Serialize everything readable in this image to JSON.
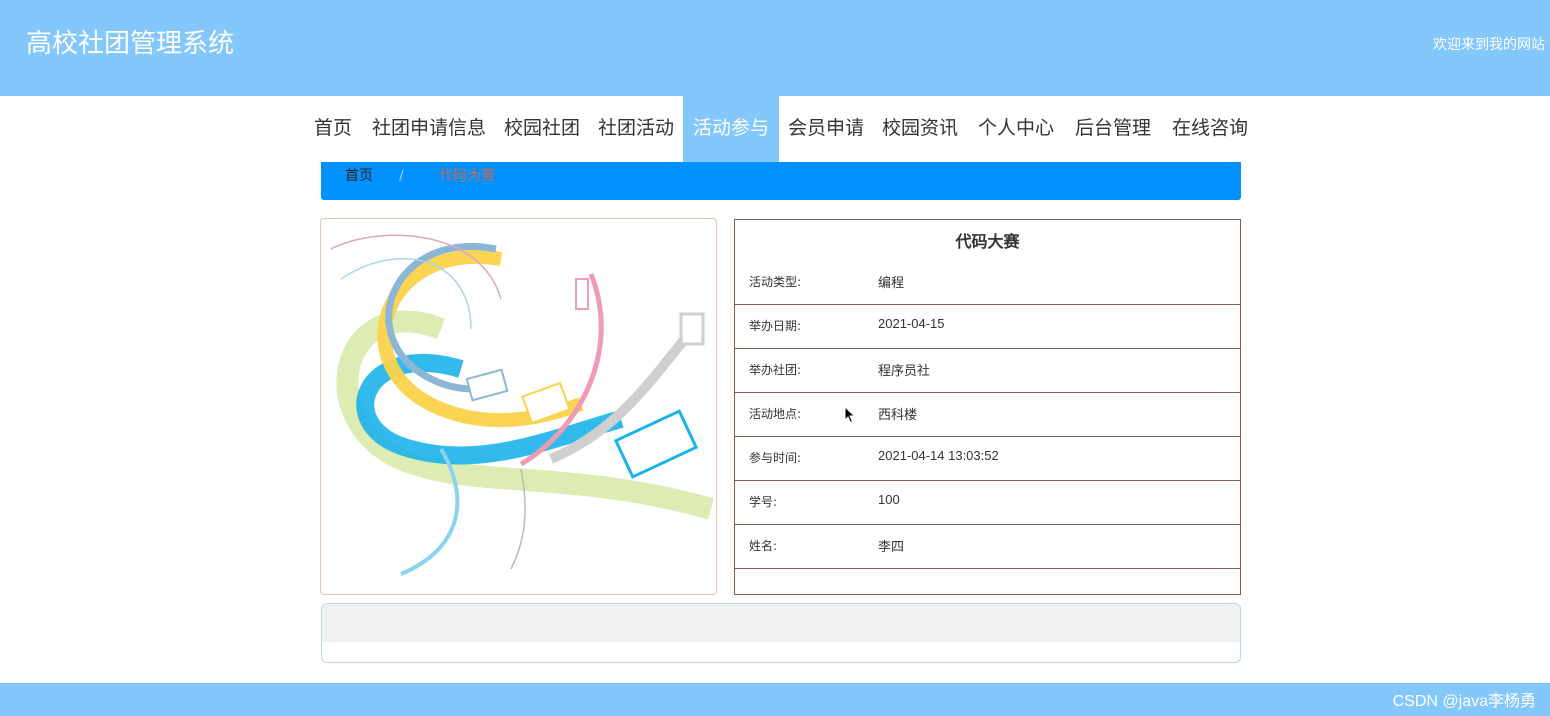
{
  "header": {
    "site_title": "高校社团管理系统",
    "welcome": "欢迎来到我的网站"
  },
  "nav": {
    "items": [
      {
        "label": "首页",
        "active": false
      },
      {
        "label": "社团申请信息",
        "active": false
      },
      {
        "label": "校园社团",
        "active": false
      },
      {
        "label": "社团活动",
        "active": false
      },
      {
        "label": "活动参与",
        "active": true
      },
      {
        "label": "会员申请",
        "active": false
      },
      {
        "label": "校园资讯",
        "active": false
      },
      {
        "label": "个人中心",
        "active": false
      },
      {
        "label": "后台管理",
        "active": false
      },
      {
        "label": "在线咨询",
        "active": false
      }
    ]
  },
  "breadcrumb": {
    "home": "首页",
    "separator": "/",
    "current": "代码大赛"
  },
  "detail": {
    "title": "代码大赛",
    "fields": [
      {
        "label": "活动类型:",
        "value": "编程"
      },
      {
        "label": "举办日期:",
        "value": "2021-04-15"
      },
      {
        "label": "举办社团:",
        "value": "程序员社"
      },
      {
        "label": "活动地点:",
        "value": "西科楼"
      },
      {
        "label": "参与时间:",
        "value": "2021-04-14 13:03:52"
      },
      {
        "label": "学号:",
        "value": "100"
      },
      {
        "label": "姓名:",
        "value": "李四"
      }
    ]
  },
  "footer": {
    "watermark": "CSDN @java李杨勇"
  },
  "colors": {
    "header_bg": "#84c8fb",
    "breadcrumb_bg": "#0091ff",
    "border_brown": "#8b5e45"
  }
}
